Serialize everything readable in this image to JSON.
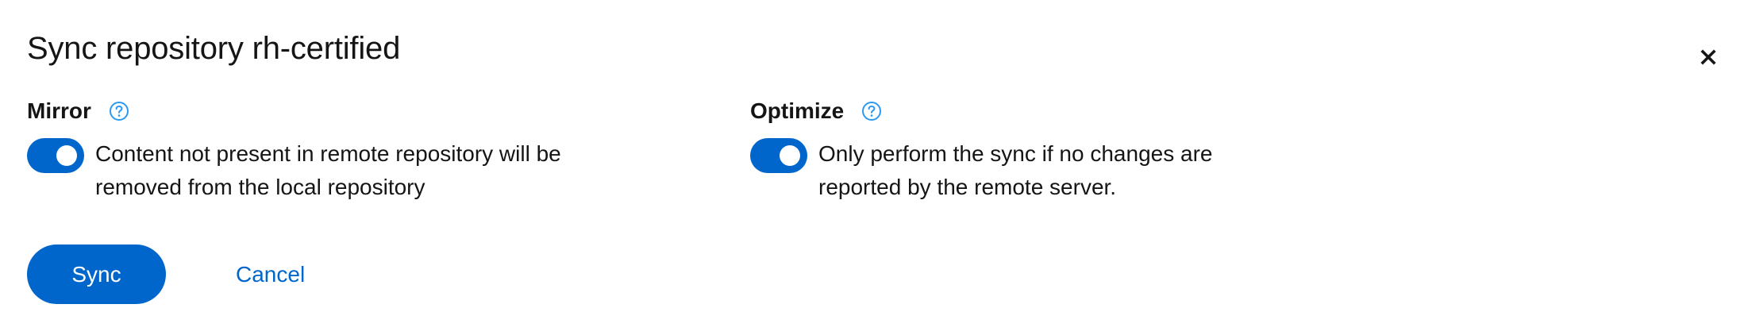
{
  "modal": {
    "title": "Sync repository rh-certified"
  },
  "mirror": {
    "label": "Mirror",
    "enabled": true,
    "description_line1": "Content not present in remote repository will be",
    "description_line2": "removed from the local repository"
  },
  "optimize": {
    "label": "Optimize",
    "enabled": true,
    "description_line1": "Only perform the sync if no changes are",
    "description_line2": "reported by the remote server."
  },
  "actions": {
    "sync_label": "Sync",
    "cancel_label": "Cancel"
  },
  "icons": {
    "close": "close-icon",
    "help": "help-icon"
  },
  "colors": {
    "primary": "#0066cc",
    "text": "#151515",
    "help_icon": "#2b9af3"
  }
}
